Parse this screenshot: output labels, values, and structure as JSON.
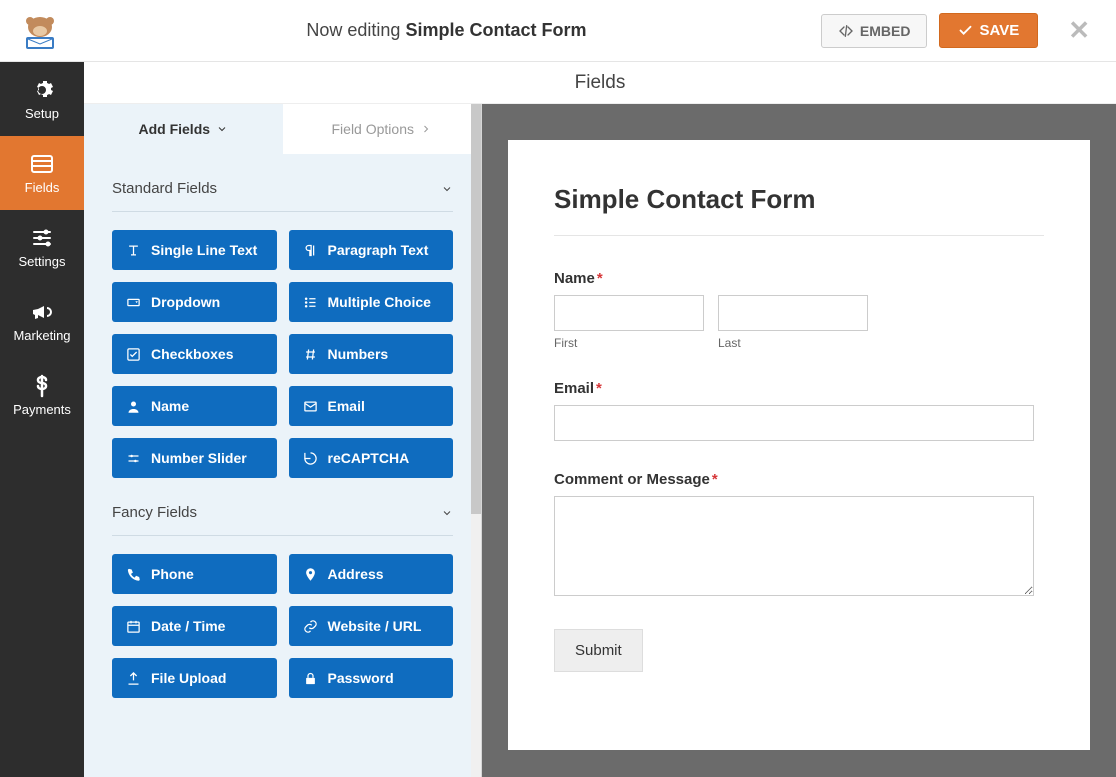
{
  "header": {
    "editing_prefix": "Now editing",
    "form_name": "Simple Contact Form",
    "embed_label": "EMBED",
    "save_label": "SAVE"
  },
  "nav": {
    "items": [
      {
        "id": "setup",
        "label": "Setup",
        "icon": "gear"
      },
      {
        "id": "fields",
        "label": "Fields",
        "icon": "list",
        "active": true
      },
      {
        "id": "settings",
        "label": "Settings",
        "icon": "sliders"
      },
      {
        "id": "marketing",
        "label": "Marketing",
        "icon": "bullhorn"
      },
      {
        "id": "payments",
        "label": "Payments",
        "icon": "dollar"
      }
    ]
  },
  "panel": {
    "title": "Fields",
    "tabs": {
      "add": "Add Fields",
      "options": "Field Options"
    },
    "groups": [
      {
        "name": "Standard Fields",
        "fields": [
          {
            "label": "Single Line Text",
            "icon": "text"
          },
          {
            "label": "Paragraph Text",
            "icon": "paragraph"
          },
          {
            "label": "Dropdown",
            "icon": "dropdown"
          },
          {
            "label": "Multiple Choice",
            "icon": "listul"
          },
          {
            "label": "Checkboxes",
            "icon": "check"
          },
          {
            "label": "Numbers",
            "icon": "hash"
          },
          {
            "label": "Name",
            "icon": "user"
          },
          {
            "label": "Email",
            "icon": "mail"
          },
          {
            "label": "Number Slider",
            "icon": "sliders-h"
          },
          {
            "label": "reCAPTCHA",
            "icon": "recaptcha"
          }
        ]
      },
      {
        "name": "Fancy Fields",
        "fields": [
          {
            "label": "Phone",
            "icon": "phone"
          },
          {
            "label": "Address",
            "icon": "pin"
          },
          {
            "label": "Date / Time",
            "icon": "calendar"
          },
          {
            "label": "Website / URL",
            "icon": "link"
          },
          {
            "label": "File Upload",
            "icon": "upload"
          },
          {
            "label": "Password",
            "icon": "lock"
          }
        ]
      }
    ]
  },
  "form": {
    "title": "Simple Contact Form",
    "name_label": "Name",
    "first_sub": "First",
    "last_sub": "Last",
    "email_label": "Email",
    "message_label": "Comment or Message",
    "submit_label": "Submit"
  }
}
